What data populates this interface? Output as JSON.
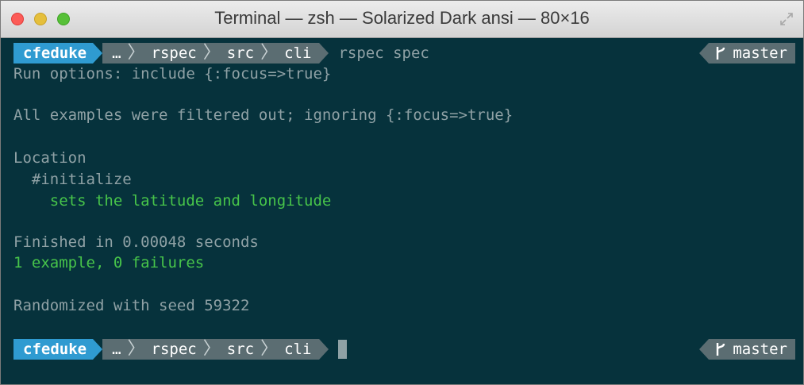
{
  "window": {
    "title": "Terminal — zsh — Solarized Dark ansi — 80×16"
  },
  "prompt1": {
    "user": "cfeduke",
    "path": [
      "…",
      "rspec",
      "src",
      "cli"
    ],
    "command": "rspec spec",
    "branch": "master"
  },
  "output": [
    {
      "text": "Run options: include {:focus=>true}",
      "color": "default"
    },
    {
      "text": "All examples were filtered out; ignoring {:focus=>true}",
      "color": "default"
    },
    {
      "text": "Location",
      "color": "default"
    },
    {
      "text": "  #initialize",
      "color": "default"
    },
    {
      "text": "    sets the latitude and longitude",
      "color": "green"
    },
    {
      "text": "Finished in 0.00048 seconds",
      "color": "default"
    },
    {
      "text": "1 example, 0 failures",
      "color": "green"
    },
    {
      "text": "Randomized with seed 59322",
      "color": "default"
    }
  ],
  "prompt2": {
    "user": "cfeduke",
    "path": [
      "…",
      "rspec",
      "src",
      "cli"
    ],
    "branch": "master"
  },
  "colors": {
    "background": "#06323c",
    "text": "#8fa1a5",
    "green": "#47c44a",
    "user_segment": "#2f9bd1",
    "path_segment": "#5b6d72"
  },
  "icons": {
    "branch": "git-branch-icon",
    "resize": "fullscreen-icon"
  }
}
